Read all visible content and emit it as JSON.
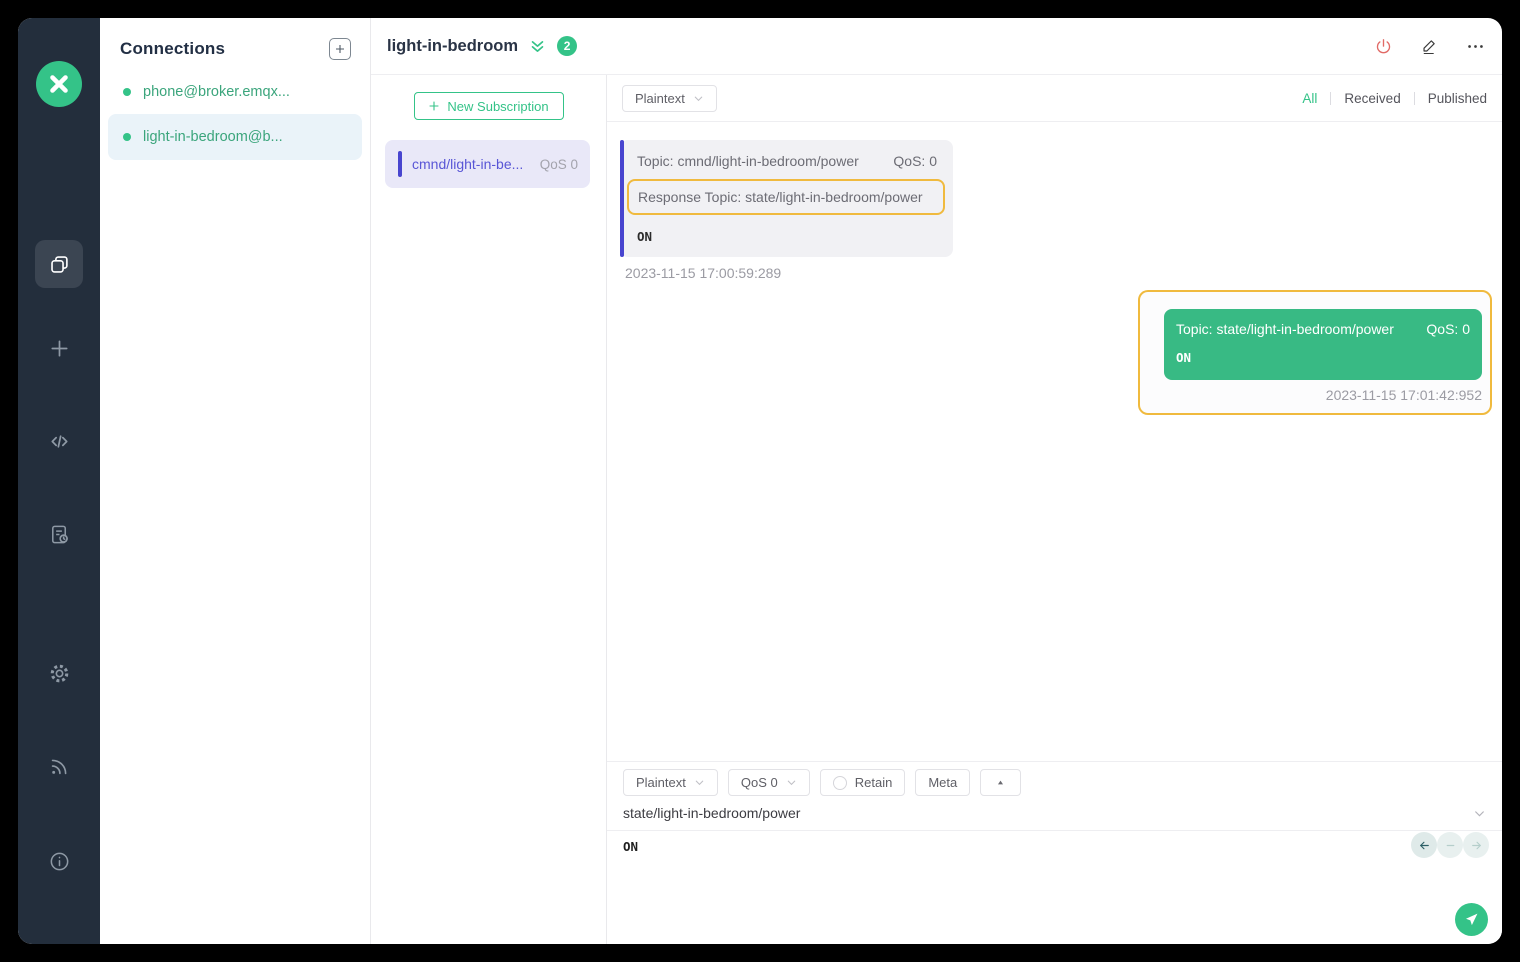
{
  "colors": {
    "brand_green": "#34c388",
    "indigo_accent": "#4845cf",
    "highlight_yellow": "#f0ba3e",
    "danger_red": "#e16a66",
    "sidebar_bg": "#232e3c",
    "published_card_green": "#38ba84"
  },
  "connections": {
    "title": "Connections",
    "items": [
      {
        "label": "phone@broker.emqx...",
        "selected": false
      },
      {
        "label": "light-in-bedroom@b...",
        "selected": true
      }
    ]
  },
  "header": {
    "title": "light-in-bedroom",
    "badge_count": "2"
  },
  "subscriptions": {
    "new_button_label": "New Subscription",
    "items": [
      {
        "topic": "cmnd/light-in-be...",
        "qos": "QoS 0"
      }
    ]
  },
  "messages": {
    "format_selected": "Plaintext",
    "filters": [
      {
        "label": "All",
        "active": true
      },
      {
        "label": "Received",
        "active": false
      },
      {
        "label": "Published",
        "active": false
      }
    ],
    "received": {
      "topic": "Topic: cmnd/light-in-bedroom/power",
      "qos": "QoS: 0",
      "response_topic": "Response Topic: state/light-in-bedroom/power",
      "payload": "ON",
      "timestamp": "2023-11-15 17:00:59:289"
    },
    "published": {
      "topic": "Topic: state/light-in-bedroom/power",
      "qos": "QoS: 0",
      "payload": "ON",
      "timestamp": "2023-11-15 17:01:42:952"
    }
  },
  "publish": {
    "format_selected": "Plaintext",
    "qos_selected": "QoS 0",
    "retain_label": "Retain",
    "meta_label": "Meta",
    "topic_value": "state/light-in-bedroom/power",
    "payload_value": "ON"
  }
}
